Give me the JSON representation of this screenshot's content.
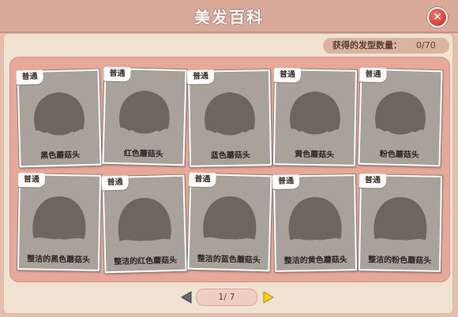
{
  "window": {
    "title": "美发百科",
    "close_symbol": "✕"
  },
  "stats": {
    "label": "获得的发型数量：",
    "value": "0/70"
  },
  "cards": [
    {
      "tag": "普通",
      "name": "黑色蘑菇头"
    },
    {
      "tag": "普通",
      "name": "红色蘑菇头"
    },
    {
      "tag": "普通",
      "name": "蓝色蘑菇头"
    },
    {
      "tag": "普通",
      "name": "黄色蘑菇头"
    },
    {
      "tag": "普通",
      "name": "粉色蘑菇头"
    },
    {
      "tag": "普通",
      "name": "整洁的黑色蘑菇头"
    },
    {
      "tag": "普通",
      "name": "整洁的红色蘑菇头"
    },
    {
      "tag": "普通",
      "name": "整洁的蓝色蘑菇头"
    },
    {
      "tag": "普通",
      "name": "整洁的黄色蘑菇头"
    },
    {
      "tag": "普通",
      "name": "整洁的粉色蘑菇头"
    }
  ],
  "pagination": {
    "page_text": "1/ 7",
    "prev_icon": "triangle-left",
    "next_icon": "triangle-right"
  },
  "colors": {
    "silhouette": "#6e665e",
    "card_bg": "#a8a29a",
    "next_arrow": "#f3d21c",
    "prev_arrow": "#6a6a74"
  }
}
